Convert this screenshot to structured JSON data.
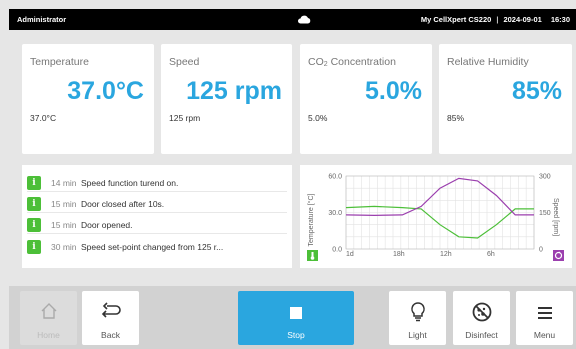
{
  "status_bar": {
    "user": "Administrator",
    "device": "My CellXpert CS220",
    "date": "2024-09-01",
    "time": "16:30",
    "icon": "cloud-icon"
  },
  "cards": [
    {
      "label": "Temperature",
      "value": "37.0°C",
      "secondary": "37.0°C"
    },
    {
      "label": "Speed",
      "value": "125 rpm",
      "secondary": "125 rpm"
    },
    {
      "label_prefix": "CO",
      "label_sub": "2",
      "label_suffix": " Concentration",
      "value": "5.0%",
      "secondary": "5.0%"
    },
    {
      "label": "Relative Humidity",
      "value": "85%",
      "secondary": "85%"
    }
  ],
  "events": [
    {
      "time": "14 min",
      "message": "Speed function turend on.",
      "icon": "info-icon"
    },
    {
      "time": "15 min",
      "message": "Door closed after 10s.",
      "icon": "info-icon"
    },
    {
      "time": "15 min",
      "message": "Door opened.",
      "icon": "info-icon"
    },
    {
      "time": "30 min",
      "message": "Speed set-point changed from 125 r...",
      "icon": "info-icon"
    }
  ],
  "chart_data": {
    "type": "line",
    "x_ticks": [
      "1d",
      "18h",
      "12h",
      "6h"
    ],
    "y_left": {
      "label": "Temperature [°C]",
      "ticks": [
        "60.0",
        "30.0",
        "0.0"
      ],
      "lim": [
        0,
        60
      ]
    },
    "y_right": {
      "label": "Speed [rpm]",
      "ticks": [
        "300",
        "150",
        "0"
      ],
      "lim": [
        0,
        300
      ]
    },
    "series": [
      {
        "axis": "left",
        "color": "#4cbf38",
        "x": [
          0,
          0.15,
          0.3,
          0.4,
          0.5,
          0.6,
          0.7,
          0.8,
          0.9,
          1.0
        ],
        "values": [
          34,
          35,
          34,
          33,
          20,
          10,
          9,
          20,
          33,
          33
        ]
      },
      {
        "axis": "right",
        "color": "#9b3fae",
        "x": [
          0,
          0.15,
          0.3,
          0.4,
          0.5,
          0.6,
          0.7,
          0.8,
          0.9,
          1.0
        ],
        "values": [
          140,
          138,
          140,
          175,
          250,
          290,
          280,
          220,
          140,
          140
        ]
      }
    ],
    "grid": true,
    "colors": {
      "temperature": "#4cbf38",
      "speed": "#9b3fae"
    }
  },
  "toolbar": {
    "home": "Home",
    "back": "Back",
    "stop": "Stop",
    "light": "Light",
    "disinfect": "Disinfect",
    "menu": "Menu"
  },
  "colors": {
    "accent": "#2aa6df",
    "info": "#4cbf38",
    "speed": "#9b3fae"
  }
}
